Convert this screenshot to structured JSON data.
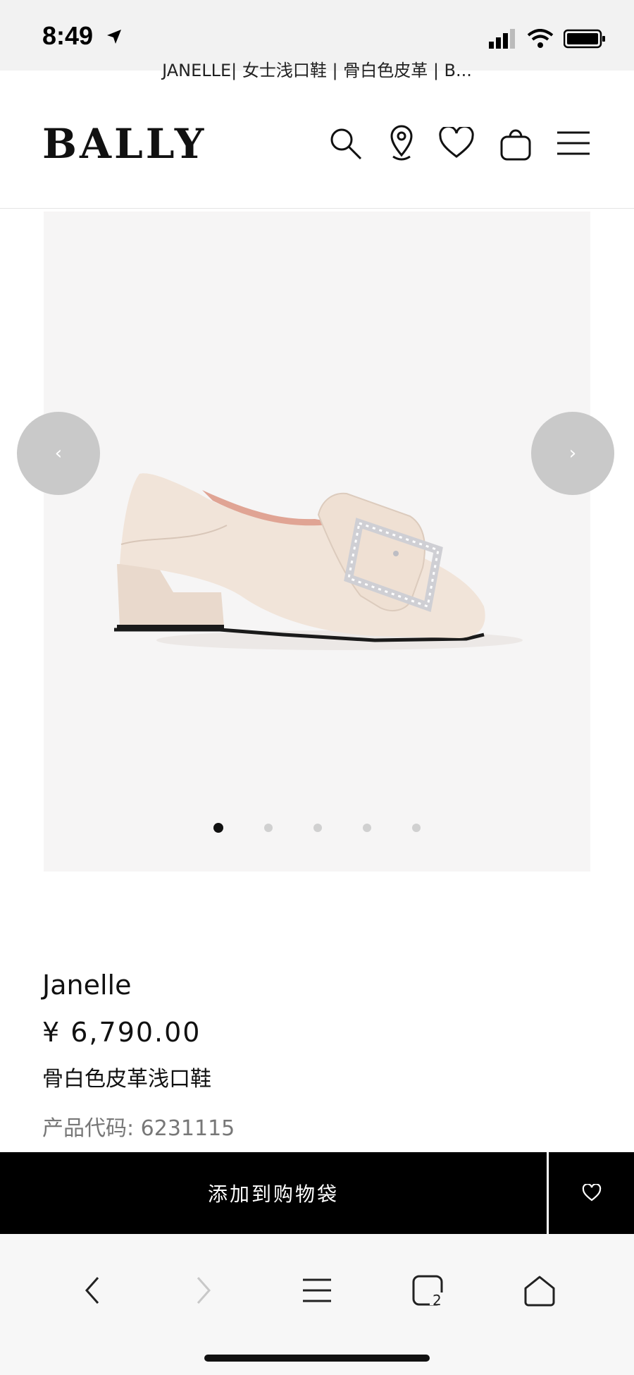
{
  "status": {
    "time": "8:49"
  },
  "browser": {
    "page_title": "JANELLE| 女士浅口鞋 | 骨白色皮革 | B..."
  },
  "header": {
    "brand": "BALLY",
    "icons": [
      "search-icon",
      "location-pin-icon",
      "heart-icon",
      "shopping-bag-icon",
      "menu-icon"
    ]
  },
  "gallery": {
    "prev_label": "‹",
    "next_label": "›",
    "dots_count": 5,
    "active_dot": 1
  },
  "product": {
    "name": "Janelle",
    "price": "¥ 6,790.00",
    "description": "骨白色皮革浅口鞋",
    "code": "产品代码: 6231115"
  },
  "cart": {
    "add_label": "添加到购物袋"
  },
  "colors": {
    "accent": "#000000",
    "background": "#ffffff",
    "gallery_bg": "#f6f5f5",
    "shoe": "#f1e4d9"
  }
}
